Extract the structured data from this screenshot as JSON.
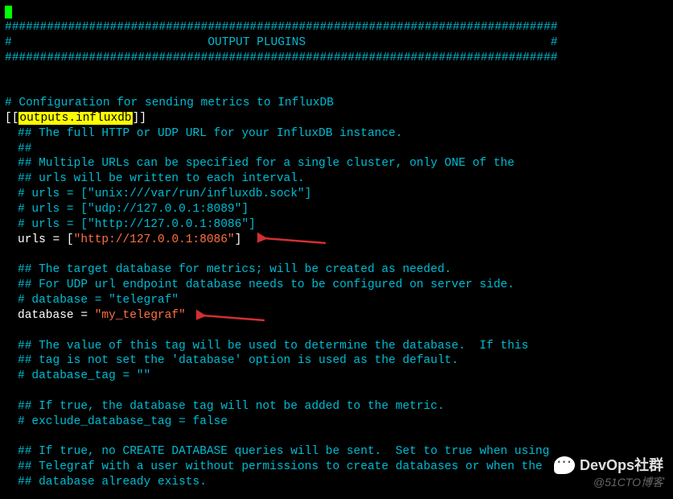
{
  "cursor_visible": true,
  "border_top": "###############################################################################",
  "border_title_left": "#",
  "border_title_center": "OUTPUT PLUGINS",
  "border_title_right": "#",
  "border_bottom": "###############################################################################",
  "section_header": "# Configuration for sending metrics to InfluxDB",
  "section_open": "[[",
  "section_name": "outputs.influxdb",
  "section_close": "]]",
  "comments": {
    "c1": "## The full HTTP or UDP URL for your InfluxDB instance.",
    "c2": "##",
    "c3": "## Multiple URLs can be specified for a single cluster, only ONE of the",
    "c4": "## urls will be written to each interval.",
    "c5": "# urls = [\"unix:///var/run/influxdb.sock\"]",
    "c6": "# urls = [\"udp://127.0.0.1:8089\"]",
    "c7": "# urls = [\"http://127.0.0.1:8086\"]"
  },
  "urls_key": "urls = [",
  "urls_value": "\"http://127.0.0.1:8086\"",
  "urls_close": "]",
  "db_comments": {
    "d1": "## The target database for metrics; will be created as needed.",
    "d2": "## For UDP url endpoint database needs to be configured on server side.",
    "d3": "# database = \"telegraf\""
  },
  "db_key": "database = ",
  "db_value": "\"my_telegraf\"",
  "tail_comments": {
    "t1": "## The value of this tag will be used to determine the database.  If this",
    "t2": "## tag is not set the 'database' option is used as the default.",
    "t3": "# database_tag = \"\"",
    "t4": "## If true, the database tag will not be added to the metric.",
    "t5": "# exclude_database_tag = false",
    "t6": "## If true, no CREATE DATABASE queries will be sent.  Set to true when using",
    "t7": "## Telegraf with a user without permissions to create databases or when the",
    "t8": "## database already exists."
  },
  "watermark1": "DevOps社群",
  "watermark2": "@51CTO博客"
}
